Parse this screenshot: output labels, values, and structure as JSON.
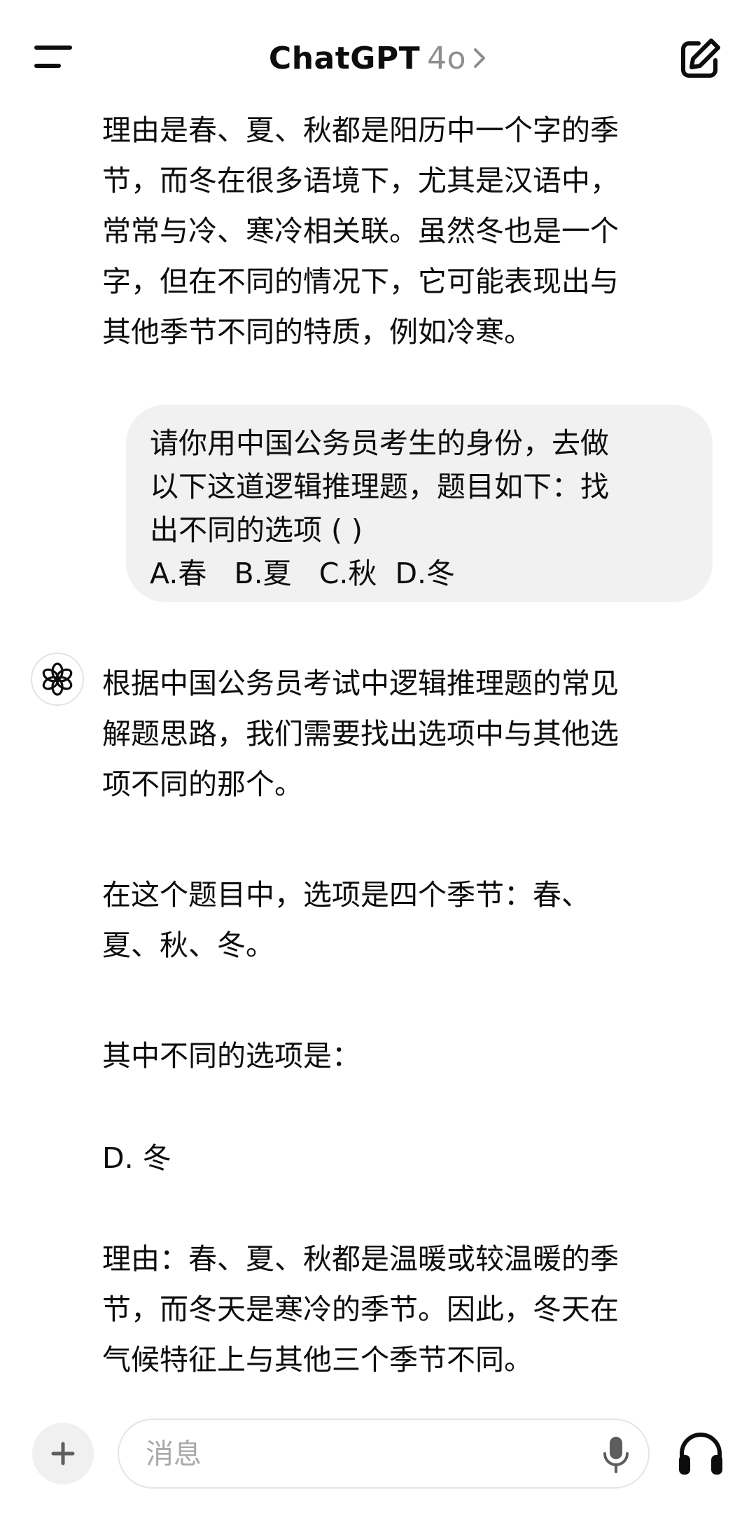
{
  "header": {
    "title": "ChatGPT",
    "model": "4o"
  },
  "conversation": {
    "assistant_prev": "理由是春、夏、秋都是阳历中一个字的季\n节，而冬在很多语境下，尤其是汉语中，\n常常与冷、寒冷相关联。虽然冬也是一个\n字，但在不同的情况下，它可能表现出与\n其他季节不同的特质，例如冷寒。",
    "user_message": "请你用中国公务员考生的身份，去做\n以下这道逻辑推理题，题目如下：找\n出不同的选项 ( )\nA.春   B.夏   C.秋  D.冬",
    "assistant_reply": {
      "para1": "根据中国公务员考试中逻辑推理题的常见\n解题思路，我们需要找出选项中与其他选\n项不同的那个。",
      "para2": "在这个题目中，选项是四个季节：春、\n夏、秋、冬。",
      "para3": "其中不同的选项是：",
      "para4": "D. 冬",
      "para5": "理由：春、夏、秋都是温暖或较温暖的季\n节，而冬天是寒冷的季节。因此，冬天在\n气候特征上与其他三个季节不同。"
    }
  },
  "composer": {
    "placeholder": "消息"
  },
  "icons": {
    "menu": "menu-icon",
    "new_chat": "new-chat-icon",
    "openai_logo": "openai-logo-icon",
    "plus": "plus-icon",
    "mic": "microphone-icon",
    "voice": "headphones-icon"
  },
  "colors": {
    "user_bubble": "#f1f1f1",
    "model_label": "#8e8e8e",
    "placeholder": "#a9a9a9"
  }
}
